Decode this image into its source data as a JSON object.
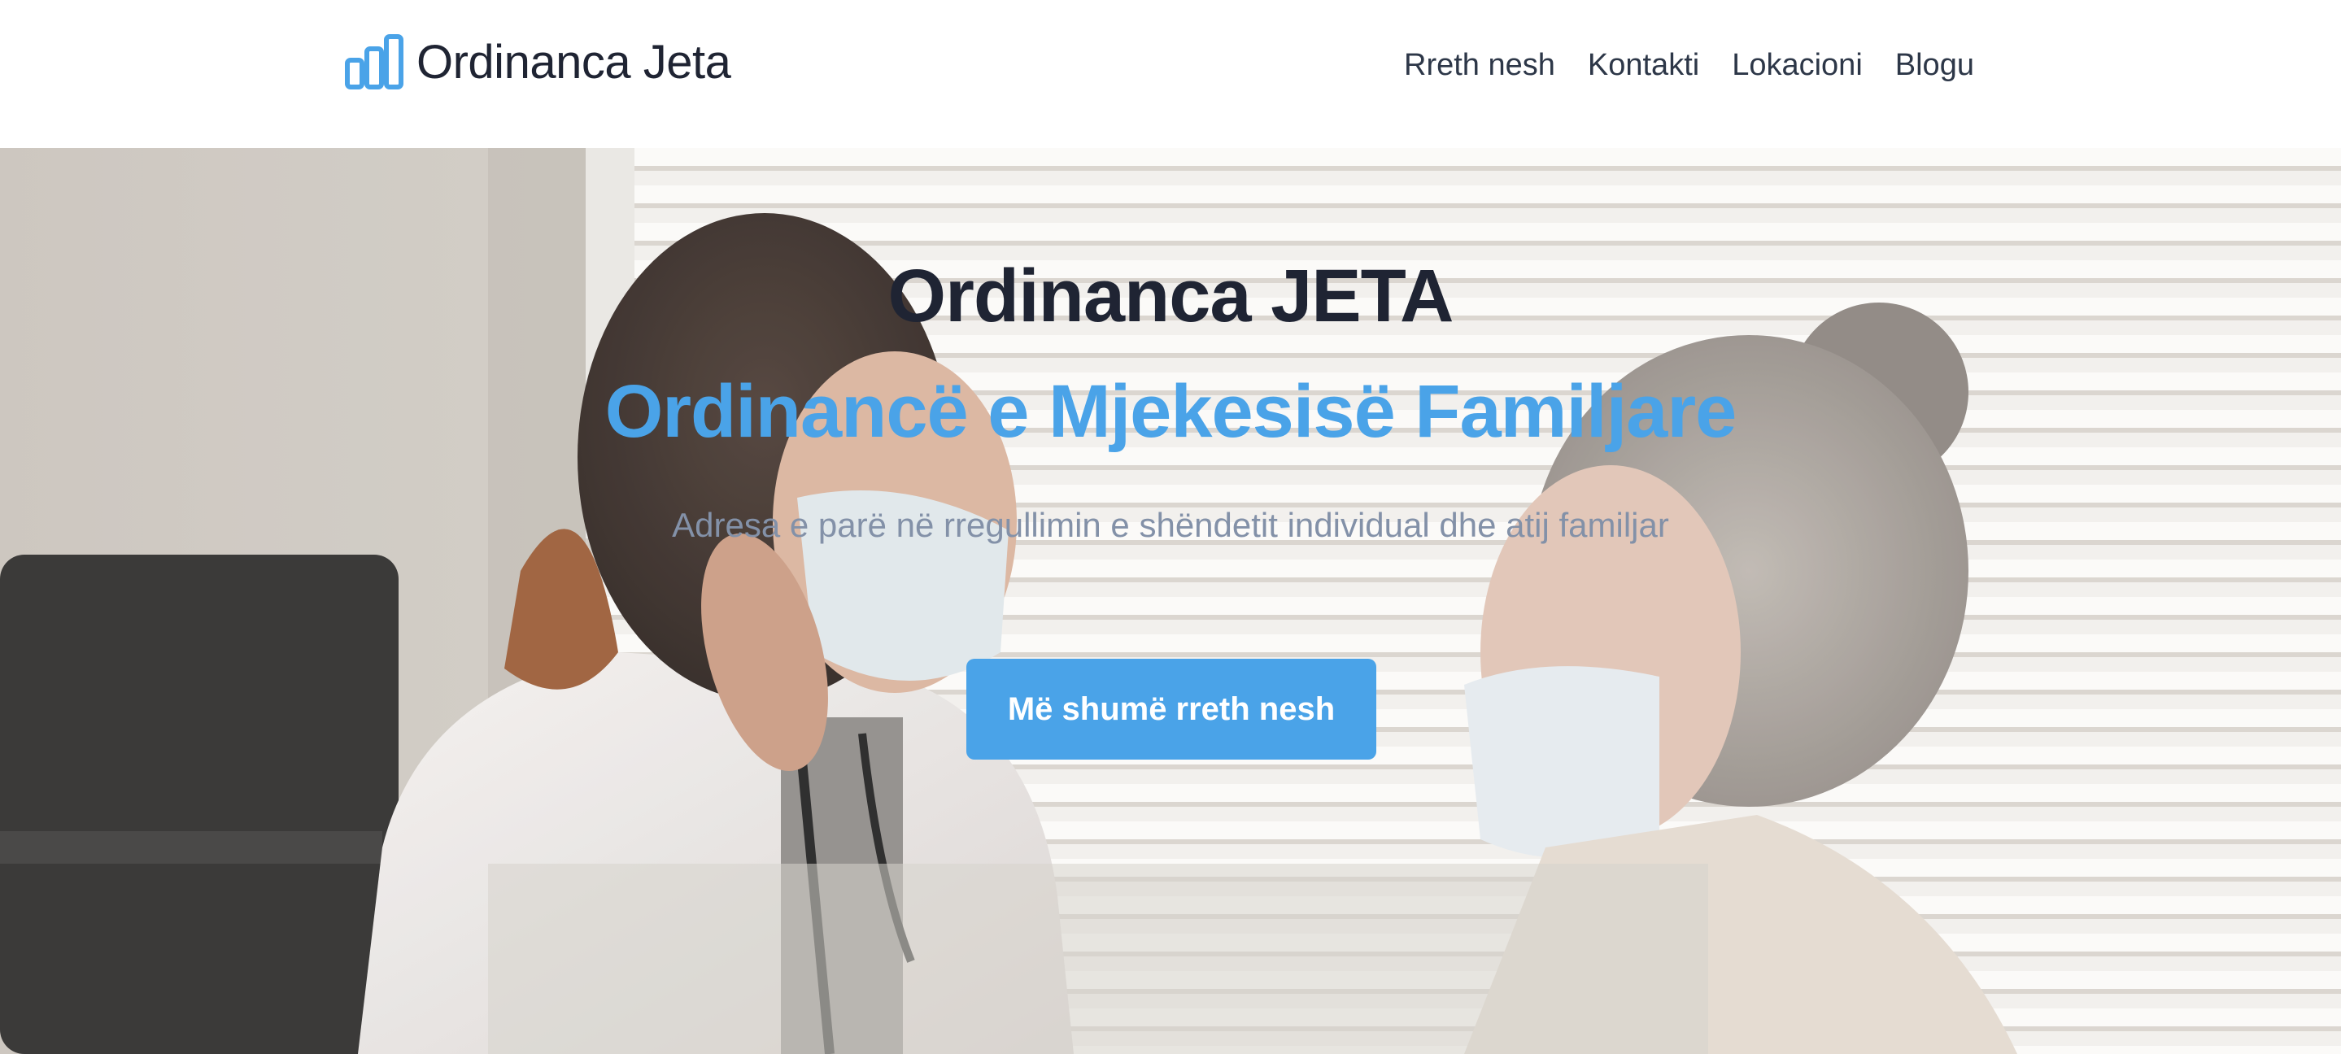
{
  "header": {
    "brand_name": "Ordinanca Jeta",
    "brand_icon": "bar-chart-icon",
    "nav": [
      {
        "label": "Rreth nesh"
      },
      {
        "label": "Kontakti"
      },
      {
        "label": "Lokacioni"
      },
      {
        "label": "Blogu"
      }
    ]
  },
  "hero": {
    "title": "Ordinanca JETA",
    "subtitle": "Ordinancë e Mjekesisë Familjare",
    "tagline": "Adresa e parë në rregullimin e shëndetit individual dhe atij familjar",
    "cta_label": "Më shumë rreth nesh",
    "background_image": "doctor-and-patient-with-masks-photo"
  },
  "colors": {
    "accent": "#4aa3e8",
    "heading": "#1f2433",
    "nav_text": "#2d3748",
    "tagline": "#8391a8"
  }
}
